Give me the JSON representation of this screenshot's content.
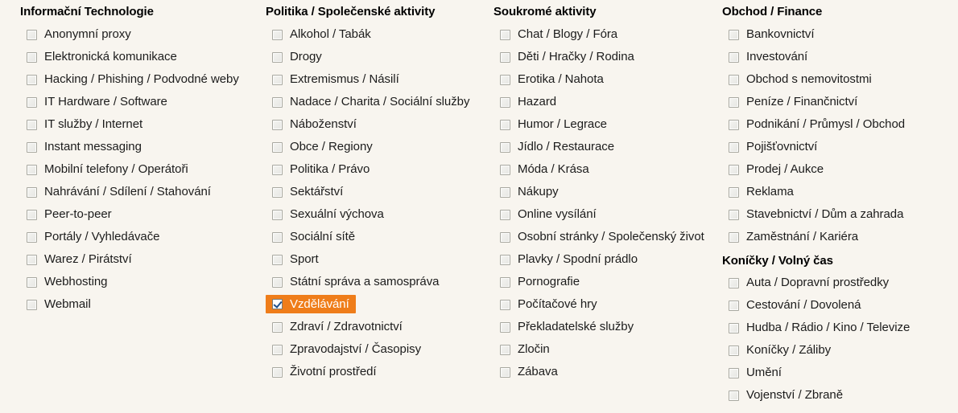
{
  "page": {
    "background_color": "#f8f5ef",
    "highlight_color": "#ef7d1a",
    "highlight_text_color": "#ffffff"
  },
  "columns": [
    {
      "groups": [
        {
          "title": "Informační Technologie",
          "items": [
            {
              "label": "Anonymní proxy",
              "checked": false
            },
            {
              "label": "Elektronická komunikace",
              "checked": false
            },
            {
              "label": "Hacking / Phishing / Podvodné weby",
              "checked": false
            },
            {
              "label": "IT Hardware / Software",
              "checked": false
            },
            {
              "label": "IT služby / Internet",
              "checked": false
            },
            {
              "label": "Instant messaging",
              "checked": false
            },
            {
              "label": "Mobilní telefony / Operátoři",
              "checked": false
            },
            {
              "label": "Nahrávání / Sdílení / Stahování",
              "checked": false
            },
            {
              "label": "Peer-to-peer",
              "checked": false
            },
            {
              "label": "Portály / Vyhledávače",
              "checked": false
            },
            {
              "label": "Warez / Pirátství",
              "checked": false
            },
            {
              "label": "Webhosting",
              "checked": false
            },
            {
              "label": "Webmail",
              "checked": false
            }
          ]
        }
      ]
    },
    {
      "groups": [
        {
          "title": "Politika / Společenské aktivity",
          "items": [
            {
              "label": "Alkohol / Tabák",
              "checked": false
            },
            {
              "label": "Drogy",
              "checked": false
            },
            {
              "label": "Extremismus / Násilí",
              "checked": false
            },
            {
              "label": "Nadace / Charita / Sociální služby",
              "checked": false
            },
            {
              "label": "Náboženství",
              "checked": false
            },
            {
              "label": "Obce / Regiony",
              "checked": false
            },
            {
              "label": "Politika / Právo",
              "checked": false
            },
            {
              "label": "Sektářství",
              "checked": false
            },
            {
              "label": "Sexuální výchova",
              "checked": false
            },
            {
              "label": "Sociální sítě",
              "checked": false
            },
            {
              "label": "Sport",
              "checked": false
            },
            {
              "label": "Státní správa a samospráva",
              "checked": false
            },
            {
              "label": "Vzdělávání",
              "checked": true
            },
            {
              "label": "Zdraví / Zdravotnictví",
              "checked": false
            },
            {
              "label": "Zpravodajství / Časopisy",
              "checked": false
            },
            {
              "label": "Životní prostředí",
              "checked": false
            }
          ]
        }
      ]
    },
    {
      "groups": [
        {
          "title": "Soukromé aktivity",
          "items": [
            {
              "label": "Chat / Blogy / Fóra",
              "checked": false
            },
            {
              "label": "Děti / Hračky / Rodina",
              "checked": false
            },
            {
              "label": "Erotika / Nahota",
              "checked": false
            },
            {
              "label": "Hazard",
              "checked": false
            },
            {
              "label": "Humor / Legrace",
              "checked": false
            },
            {
              "label": "Jídlo / Restaurace",
              "checked": false
            },
            {
              "label": "Móda / Krása",
              "checked": false
            },
            {
              "label": "Nákupy",
              "checked": false
            },
            {
              "label": "Online vysílání",
              "checked": false
            },
            {
              "label": "Osobní stránky / Společenský život",
              "checked": false
            },
            {
              "label": "Plavky / Spodní prádlo",
              "checked": false
            },
            {
              "label": "Pornografie",
              "checked": false
            },
            {
              "label": "Počítačové hry",
              "checked": false
            },
            {
              "label": "Překladatelské služby",
              "checked": false
            },
            {
              "label": "Zločin",
              "checked": false
            },
            {
              "label": "Zábava",
              "checked": false
            }
          ]
        }
      ]
    },
    {
      "groups": [
        {
          "title": "Obchod / Finance",
          "items": [
            {
              "label": "Bankovnictví",
              "checked": false
            },
            {
              "label": "Investování",
              "checked": false
            },
            {
              "label": "Obchod s nemovitostmi",
              "checked": false
            },
            {
              "label": "Peníze / Finančnictví",
              "checked": false
            },
            {
              "label": "Podnikání / Průmysl / Obchod",
              "checked": false
            },
            {
              "label": "Pojišťovnictví",
              "checked": false
            },
            {
              "label": "Prodej / Aukce",
              "checked": false
            },
            {
              "label": "Reklama",
              "checked": false
            },
            {
              "label": "Stavebnictví / Dům a zahrada",
              "checked": false
            },
            {
              "label": "Zaměstnání / Kariéra",
              "checked": false
            }
          ]
        },
        {
          "title": "Koníčky / Volný čas",
          "items": [
            {
              "label": "Auta / Dopravní prostředky",
              "checked": false
            },
            {
              "label": "Cestování / Dovolená",
              "checked": false
            },
            {
              "label": "Hudba / Rádio / Kino / Televize",
              "checked": false
            },
            {
              "label": "Koníčky / Záliby",
              "checked": false
            },
            {
              "label": "Umění",
              "checked": false
            },
            {
              "label": "Vojenství / Zbraně",
              "checked": false
            }
          ]
        }
      ]
    }
  ]
}
